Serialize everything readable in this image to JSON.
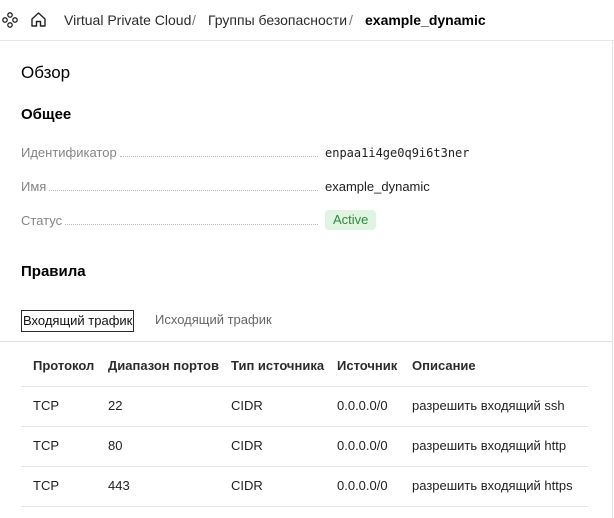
{
  "header": {
    "breadcrumbs": [
      "Virtual Private Cloud",
      "Группы безопасности",
      "example_dynamic"
    ],
    "separator": "/"
  },
  "overview": {
    "title": "Обзор",
    "general_title": "Общее",
    "properties": [
      {
        "label": "Идентификатор",
        "value": "enpaa1i4ge0q9i6t3ner"
      },
      {
        "label": "Имя",
        "value": "example_dynamic"
      },
      {
        "label": "Статус",
        "value": "Active"
      }
    ],
    "status_color": "#2e8a40"
  },
  "rules": {
    "title": "Правила",
    "tabs": [
      "Входящий трафик",
      "Исходящий трафик"
    ],
    "active_tab": "Входящий трафик",
    "columns": [
      "Протокол",
      "Диапазон портов",
      "Тип источника",
      "Источник",
      "Описание"
    ],
    "rows": [
      [
        "TCP",
        "22",
        "CIDR",
        "0.0.0.0/0",
        "разрешить входящий ssh"
      ],
      [
        "TCP",
        "80",
        "CIDR",
        "0.0.0.0/0",
        "разрешить входящий http"
      ],
      [
        "TCP",
        "443",
        "CIDR",
        "0.0.0.0/0",
        "разрешить входящий https"
      ]
    ]
  },
  "icons": [
    "services-menu-icon",
    "home-icon"
  ]
}
